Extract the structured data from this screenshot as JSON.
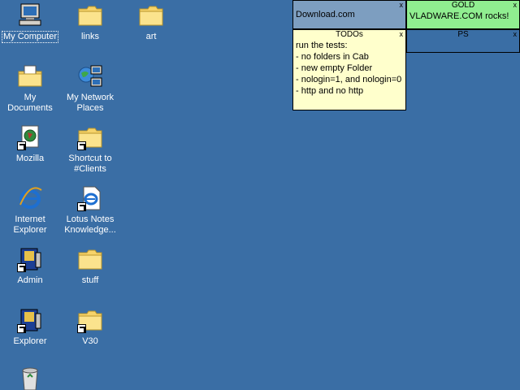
{
  "desktop": {
    "icons": [
      {
        "label": "My Computer",
        "icon": "computer-icon"
      },
      {
        "label": "links",
        "icon": "folder-icon"
      },
      {
        "label": "art",
        "icon": "folder-icon"
      },
      {
        "label": "My Documents",
        "icon": "documents-folder-icon"
      },
      {
        "label": "My Network Places",
        "icon": "network-icon"
      },
      {
        "label": "Mozilla",
        "icon": "mozilla-icon"
      },
      {
        "label": "Shortcut to #Clients",
        "icon": "folder-icon"
      },
      {
        "label": "Internet Explorer",
        "icon": "ie-icon"
      },
      {
        "label": "Lotus Notes Knowledge...",
        "icon": "lotus-notes-icon"
      },
      {
        "label": "Admin",
        "icon": "admin-book-icon"
      },
      {
        "label": "stuff",
        "icon": "folder-icon"
      },
      {
        "label": "Explorer",
        "icon": "explorer-book-icon"
      },
      {
        "label": "V30",
        "icon": "folder-icon"
      },
      {
        "label": "",
        "icon": "recycle-bin-icon"
      }
    ]
  },
  "notes": {
    "download": {
      "title": "",
      "body": "Download.com",
      "close": "x",
      "color": "#7d9ec0"
    },
    "gold": {
      "title": "GOLD",
      "body": "VLADWARE.COM rocks!",
      "close": "x",
      "color": "#90ee90"
    },
    "todos": {
      "title": "TODOs",
      "close": "x",
      "color": "#ffffcc",
      "lines": [
        "run the tests:",
        "- no folders in Cab",
        "- new empty Folder",
        "- nologin=1, and nologin=0",
        "- http and no http"
      ]
    },
    "ps": {
      "title": "PS",
      "body": "",
      "close": "x",
      "color": "#3a6ea5"
    }
  }
}
